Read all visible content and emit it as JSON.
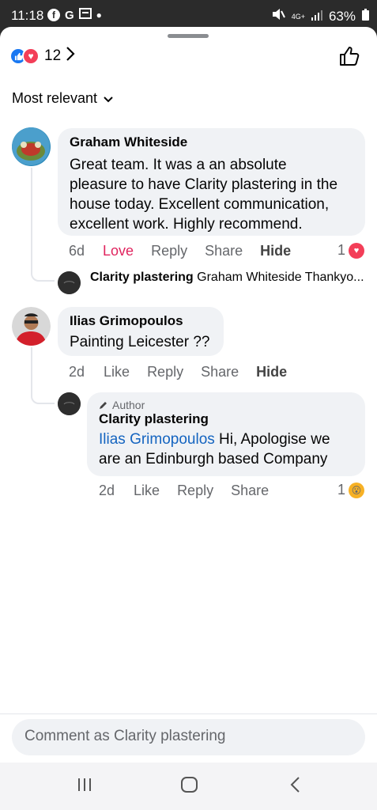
{
  "status": {
    "time": "11:18",
    "left_icons": [
      "facebook-icon",
      "google-icon",
      "gallery-icon",
      "dot"
    ],
    "g_label": "G",
    "network": "4G+",
    "battery": "63%"
  },
  "reactions": {
    "count": "12",
    "types": [
      "like",
      "love"
    ]
  },
  "sort": {
    "label": "Most relevant"
  },
  "comments": [
    {
      "author": "Graham Whiteside",
      "text": "Great team. It was a an absolute pleasure to have Clarity plastering  in the house today. Excellent communication, excellent work. Highly recommend.",
      "lines": [
        "Great team. It was a an absolute",
        "pleasure to have Clarity plastering  in the",
        "house today. Excellent communication,",
        "excellent work. Highly recommend."
      ],
      "time": "6d",
      "react_label": "Love",
      "reply": "Reply",
      "share": "Share",
      "hide": "Hide",
      "reaction_count": "1",
      "reply_preview": {
        "name": "Clarity plastering",
        "text": "Graham Whiteside Thankyo..."
      }
    },
    {
      "author": "Ilias Grimopoulos",
      "text": "Painting Leicester ??",
      "time": "2d",
      "react_label": "Like",
      "reply": "Reply",
      "share": "Share",
      "hide": "Hide",
      "reply_comment": {
        "badge": "Author",
        "author": "Clarity plastering",
        "mention": "Ilias Grimopoulos",
        "line1_rest": " Hi, Apologise we",
        "line2": "are an Edinburgh based Company",
        "time": "2d",
        "react_label": "Like",
        "reply": "Reply",
        "share": "Share",
        "reaction_count": "1"
      }
    }
  ],
  "composer": {
    "placeholder": "Comment as Clarity plastering"
  },
  "colors": {
    "like_blue": "#1877f2",
    "love_red": "#f33e58",
    "mention_blue": "#1464c0",
    "bubble_bg": "#f0f2f5"
  }
}
